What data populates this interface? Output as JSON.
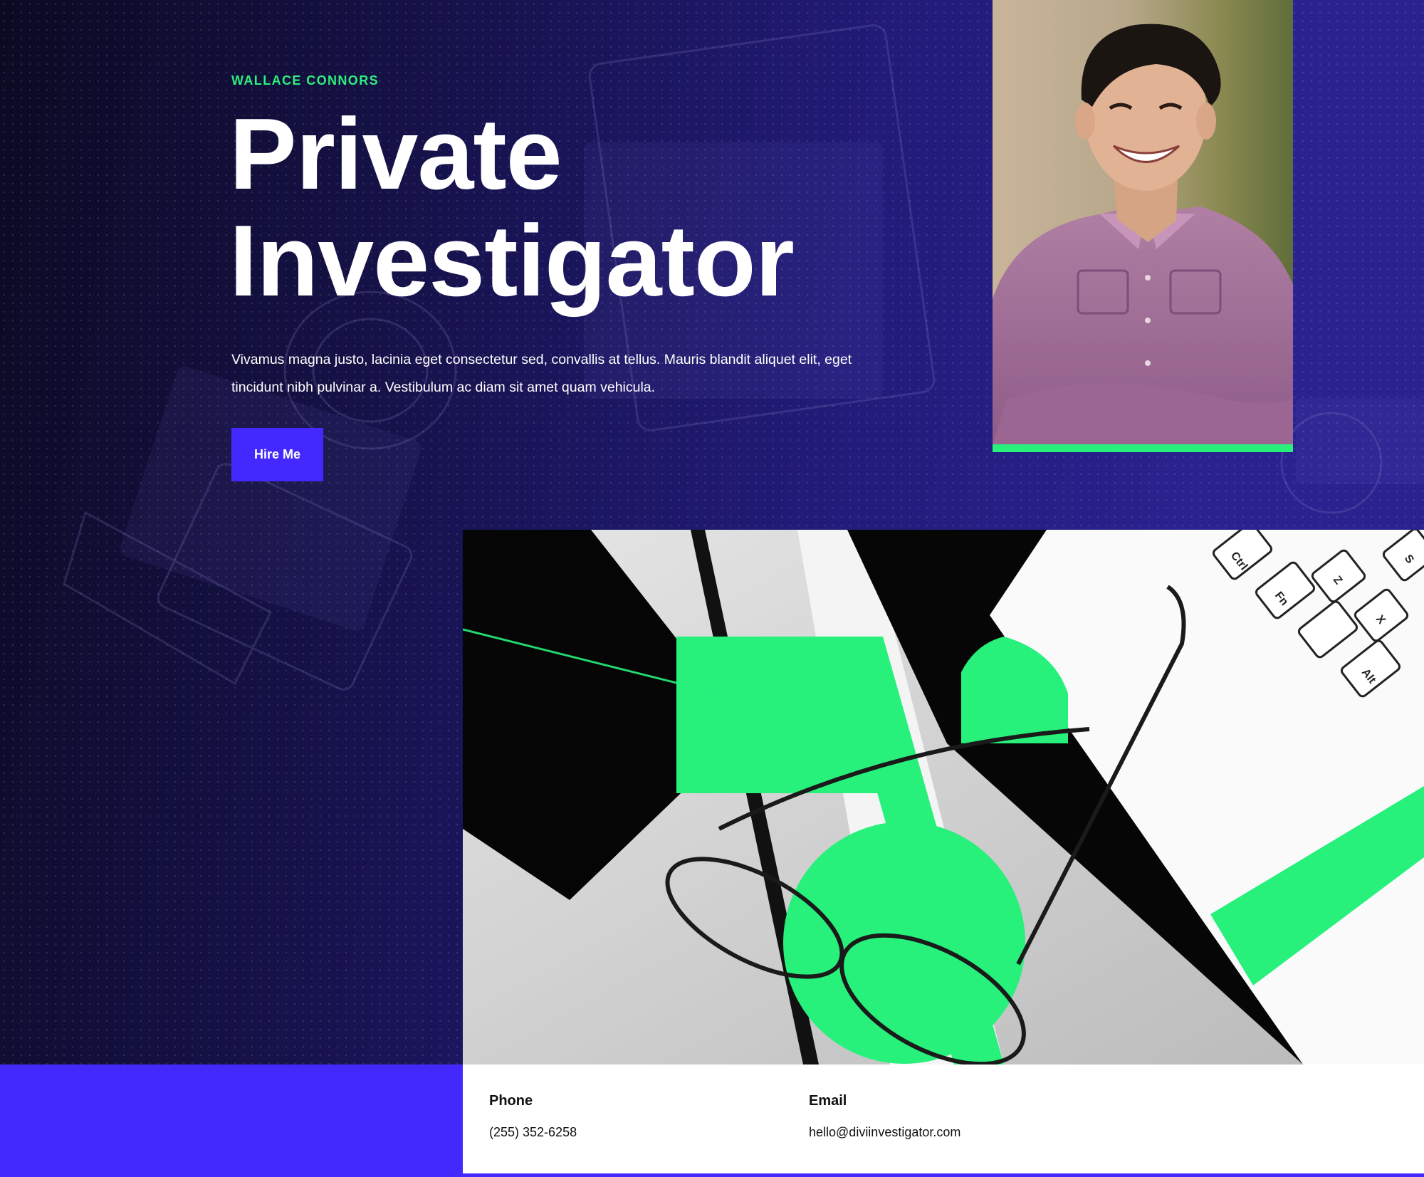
{
  "hero": {
    "eyebrow": "WALLACE CONNORS",
    "title_line1": "Private",
    "title_line2": "Investigator",
    "intro_line1": "Vivamus magna justo, lacinia eget consectetur sed, convallis at tellus. Mauris blandit aliquet elit, eget",
    "intro_line2": "tincidunt nibh pulvinar a. Vestibulum ac diam sit amet quam vehicula.",
    "button_label": "Hire Me"
  },
  "contact": {
    "phone_label": "Phone",
    "phone_value": "(255) 352-6258",
    "email_label": "Email",
    "email_value": "hello@diviinvestigator.com"
  },
  "images": {
    "portrait": "portrait-photo",
    "desk": "desk-glasses-photo",
    "background": "camera-background-photo"
  },
  "keyboard_keys": [
    "Ctrl",
    "Fn",
    "Alt",
    "Z",
    "X",
    "S"
  ],
  "colors": {
    "accent_green": "#27f07b",
    "accent_blue": "#4429ff",
    "background_navy": "#1a1550",
    "text_white": "#ffffff"
  }
}
